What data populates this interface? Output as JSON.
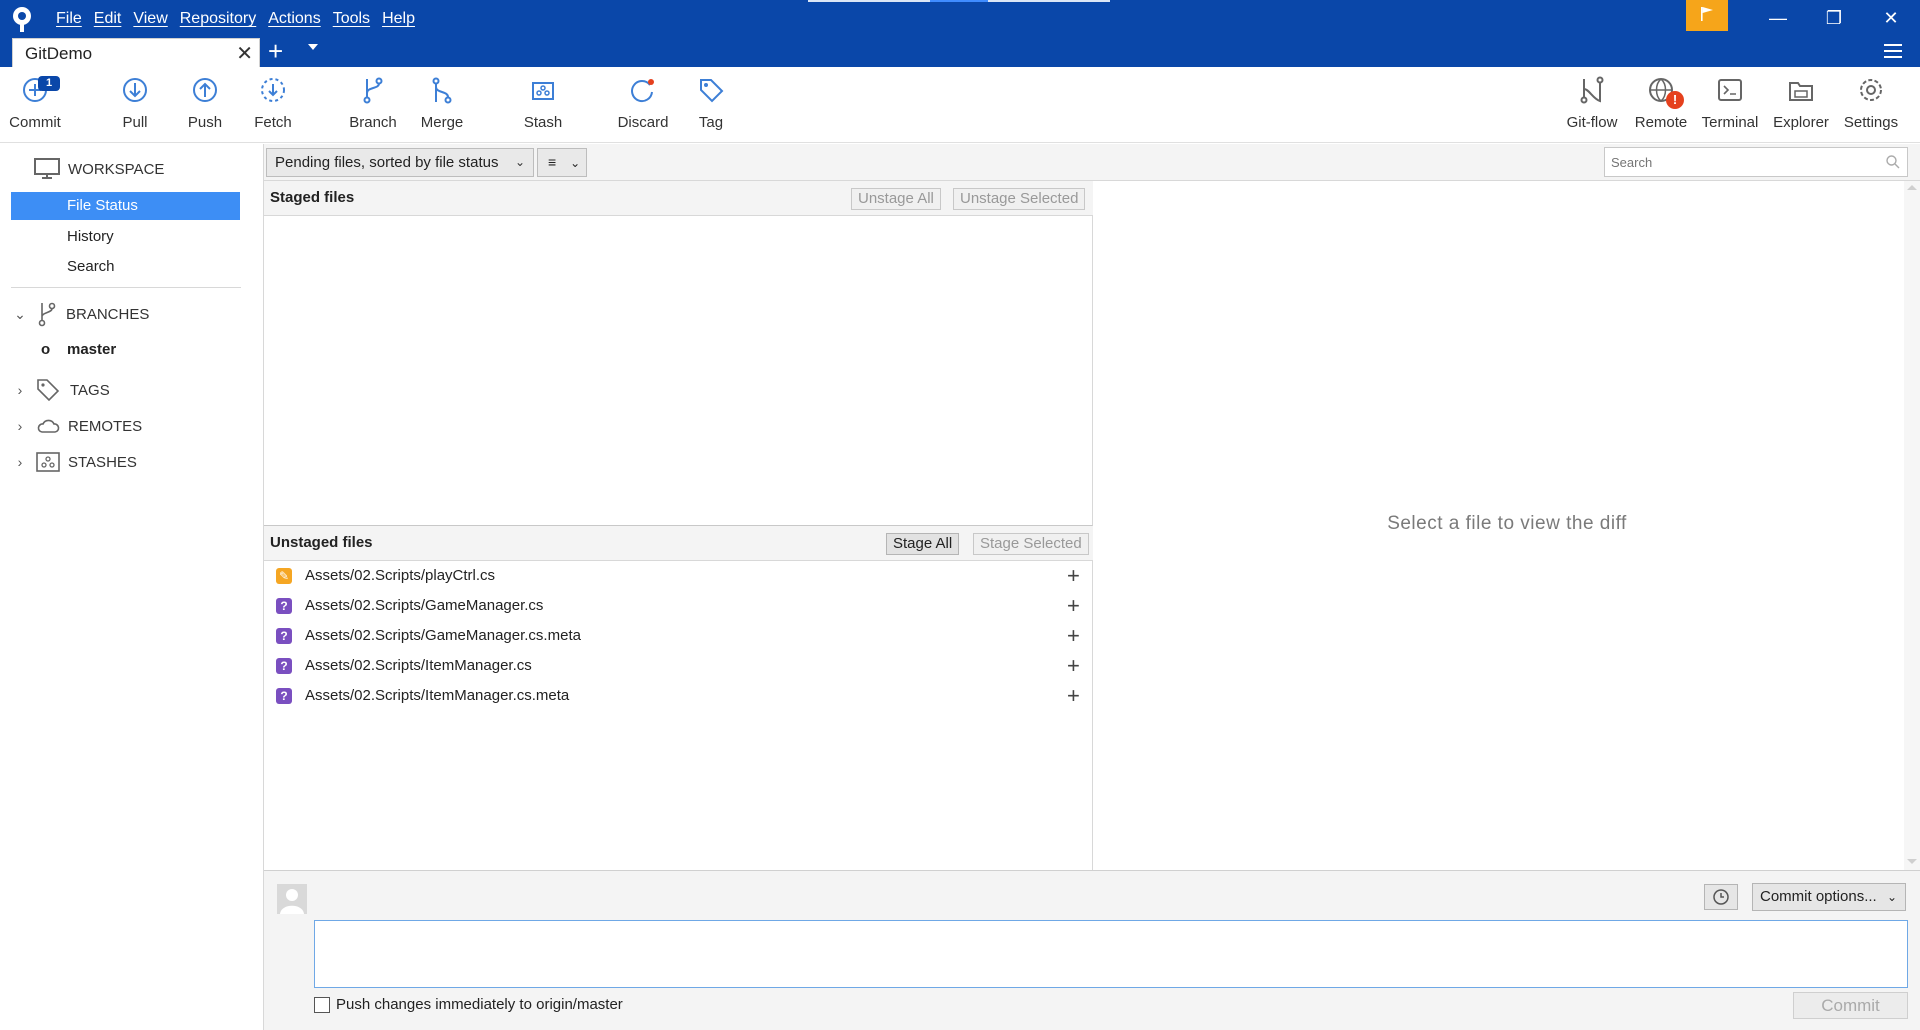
{
  "menu": [
    "File",
    "Edit",
    "View",
    "Repository",
    "Actions",
    "Tools",
    "Help"
  ],
  "window": {
    "minimize": "—",
    "restore": "❐",
    "close": "✕"
  },
  "tab": {
    "label": "GitDemo",
    "close": "✕",
    "add": "+"
  },
  "toolbar": {
    "left": [
      {
        "label": "Commit",
        "icon": "commit-icon",
        "badge": "1"
      },
      {
        "label": "Pull",
        "icon": "pull-icon"
      },
      {
        "label": "Push",
        "icon": "push-icon"
      },
      {
        "label": "Fetch",
        "icon": "fetch-icon"
      },
      {
        "label": "Branch",
        "icon": "branch-icon"
      },
      {
        "label": "Merge",
        "icon": "merge-icon"
      },
      {
        "label": "Stash",
        "icon": "stash-icon"
      },
      {
        "label": "Discard",
        "icon": "discard-icon"
      },
      {
        "label": "Tag",
        "icon": "tag-icon"
      }
    ],
    "right": [
      {
        "label": "Git-flow",
        "icon": "git-flow-icon"
      },
      {
        "label": "Remote",
        "icon": "remote-icon",
        "alert": "!"
      },
      {
        "label": "Terminal",
        "icon": "terminal-icon"
      },
      {
        "label": "Explorer",
        "icon": "explorer-icon"
      },
      {
        "label": "Settings",
        "icon": "settings-icon"
      }
    ]
  },
  "sidebar": {
    "workspace": "WORKSPACE",
    "workspace_items": [
      "File Status",
      "History",
      "Search"
    ],
    "branches": "BRANCHES",
    "current_branch": "master",
    "tags": "TAGS",
    "remotes": "REMOTES",
    "stashes": "STASHES"
  },
  "filter": {
    "select_label": "Pending files, sorted by file status",
    "view_icon": "≡",
    "search_placeholder": "Search"
  },
  "staged": {
    "title": "Staged files",
    "unstage_all": "Unstage All",
    "unstage_selected": "Unstage Selected"
  },
  "unstaged": {
    "title": "Unstaged files",
    "stage_all": "Stage All",
    "stage_selected": "Stage Selected",
    "files": [
      {
        "name": "Assets/02.Scripts/playCtrl.cs",
        "status": "modified"
      },
      {
        "name": "Assets/02.Scripts/GameManager.cs",
        "status": "untracked"
      },
      {
        "name": "Assets/02.Scripts/GameManager.cs.meta",
        "status": "untracked"
      },
      {
        "name": "Assets/02.Scripts/ItemManager.cs",
        "status": "untracked"
      },
      {
        "name": "Assets/02.Scripts/ItemManager.cs.meta",
        "status": "untracked"
      }
    ]
  },
  "diff": {
    "empty_message": "Select a file to view the diff"
  },
  "commit": {
    "options_label": "Commit options...",
    "push_label": "Push changes immediately to origin/master",
    "push_checked": false,
    "button_label": "Commit"
  },
  "colors": {
    "titlebar": "#0a47a9",
    "accent": "#3d8ef5",
    "modified": "#f5a623",
    "untracked": "#7a4fc0",
    "flag": "#f6a51a"
  }
}
